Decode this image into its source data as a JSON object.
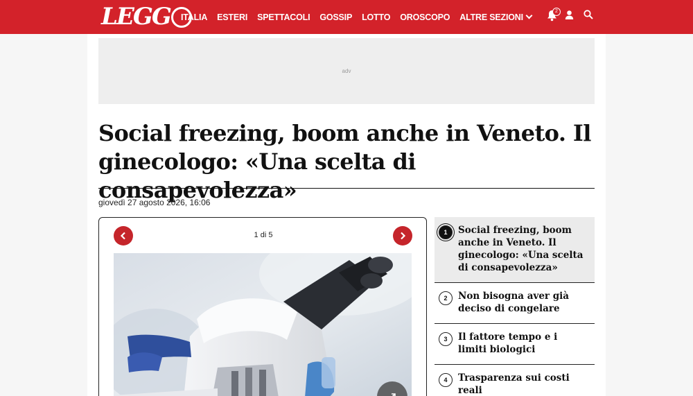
{
  "header": {
    "logo": "LEGGO",
    "nav": [
      "ITALIA",
      "ESTERI",
      "SPETTACOLI",
      "GOSSIP",
      "LOTTO",
      "OROSCOPO",
      "ALTRE SEZIONI"
    ],
    "notification_count": "2",
    "icons": [
      "bell-icon",
      "user-icon",
      "search-icon"
    ]
  },
  "ad": {
    "label": "adv"
  },
  "article": {
    "title": "Social freezing, boom anche in Veneto. Il ginecologo: «Una scelta di consapevolezza»",
    "date": "giovedì 27 agosto 2026, 16:06"
  },
  "gallery": {
    "counter": "1 di 5",
    "prev_icon": "chevron-left-icon",
    "next_icon": "chevron-right-icon",
    "expand_icon": "expand-icon"
  },
  "slides": [
    {
      "num": "1",
      "text": "Social freezing, boom anche in Veneto. Il ginecologo: «Una scelta di consapevolezza»",
      "active": true
    },
    {
      "num": "2",
      "text": "Non bisogna aver già deciso di congelare",
      "active": false
    },
    {
      "num": "3",
      "text": "Il fattore tempo e i limiti biologici",
      "active": false
    },
    {
      "num": "4",
      "text": "Trasparenza sui costi reali",
      "active": false
    }
  ],
  "colors": {
    "brand": "#d3222a",
    "arrow": "#c5252b"
  }
}
